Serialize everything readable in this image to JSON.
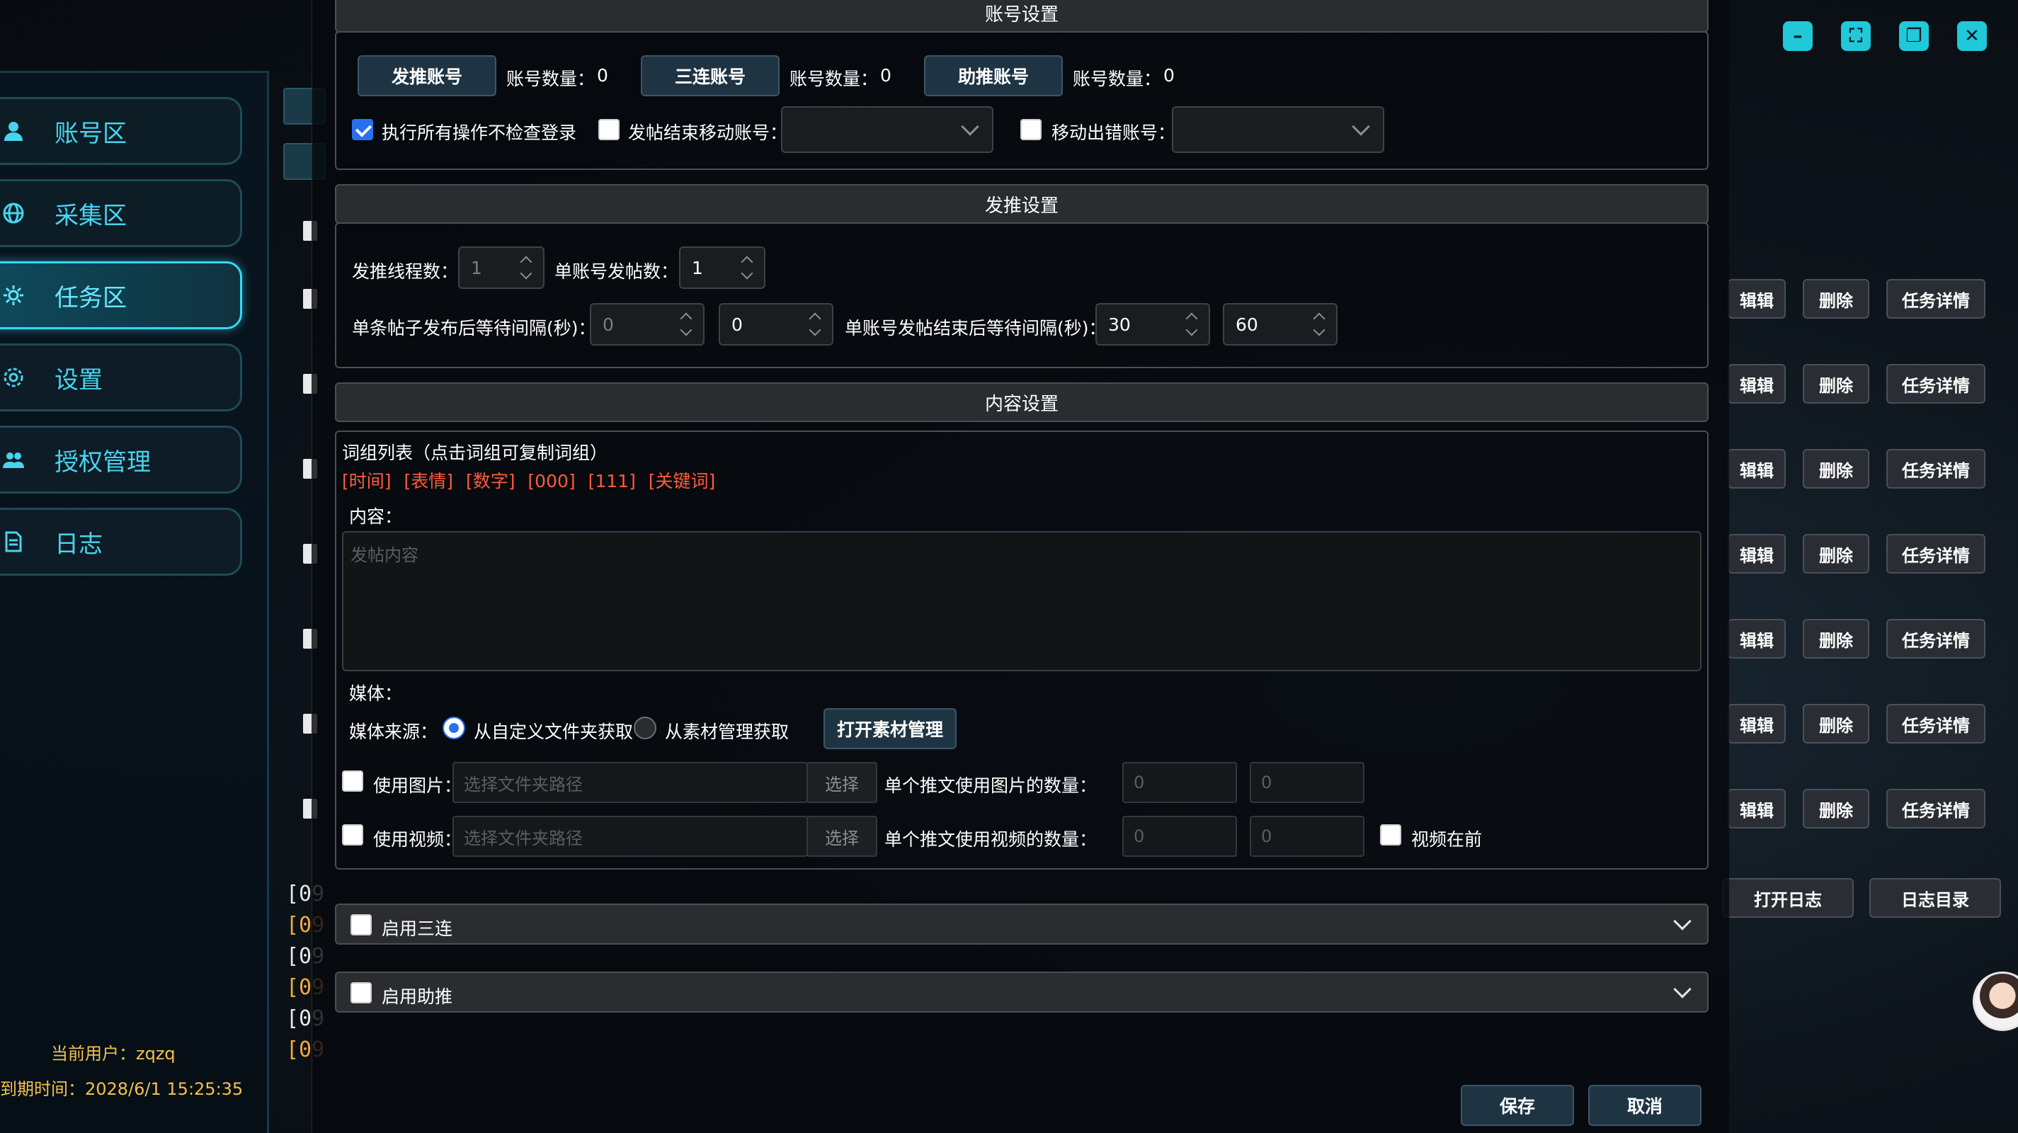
{
  "sidebar": {
    "items": [
      {
        "label": "账号区",
        "icon": "user-icon"
      },
      {
        "label": "采集区",
        "icon": "globe-icon"
      },
      {
        "label": "任务区",
        "icon": "gear-icon"
      },
      {
        "label": "设置",
        "icon": "settings-icon"
      },
      {
        "label": "授权管理",
        "icon": "users-icon"
      },
      {
        "label": "日志",
        "icon": "document-icon"
      }
    ],
    "active_index": 2,
    "user_label": "当前用户：zqzq",
    "expire_label": "到期时间：2028/6/1 15:25:35"
  },
  "log_lines": [
    "[09",
    "[09",
    "[09",
    "[09",
    "[09",
    "[09"
  ],
  "log_colors": [
    "#e6e6e6",
    "#f2a93b",
    "#e6e6e6",
    "#f2a93b",
    "#e6e6e6",
    "#f2a93b"
  ],
  "task_rows": {
    "edit_label": "辑辑",
    "delete_label": "删除",
    "detail_label": "任务详情"
  },
  "log_buttons": {
    "open_log": "打开日志",
    "log_dir": "日志目录"
  },
  "window_icons": [
    "minimize-icon",
    "fullscreen-icon",
    "restore-icon",
    "close-icon"
  ],
  "account_settings": {
    "title": "账号设置",
    "post_account_btn": "发推账号",
    "triple_account_btn": "三连账号",
    "assist_account_btn": "助推账号",
    "count_label": "账号数量：",
    "post_count": "0",
    "triple_count": "0",
    "assist_count": "0",
    "skip_login_check": {
      "label": "执行所有操作不检查登录",
      "checked": true
    },
    "move_after_post": {
      "label": "发帖结束移动账号：",
      "checked": false
    },
    "move_on_error": {
      "label": "移动出错账号：",
      "checked": false
    }
  },
  "post_settings": {
    "title": "发推设置",
    "thread_count_label": "发推线程数：",
    "thread_count": "1",
    "per_account_label": "单账号发帖数：",
    "per_account": "1",
    "wait_after_post_label": "单条帖子发布后等待间隔(秒)：",
    "wait_after_post_min": "0",
    "wait_after_post_max": "0",
    "wait_after_account_label": "单账号发帖结束后等待间隔(秒)：",
    "wait_after_account_min": "30",
    "wait_after_account_max": "60"
  },
  "content_settings": {
    "title": "内容设置",
    "wordgroup_title": "词组列表（点击词组可复制词组）",
    "wordgroup_tags": [
      "[时间]",
      "[表情]",
      "[数字]",
      "[000]",
      "[111]",
      "[关键词]"
    ],
    "content_label": "内容：",
    "content_placeholder": "发帖内容",
    "media_label": "媒体：",
    "media_source_label": "媒体来源：",
    "source_custom": "从自定义文件夹获取",
    "source_material": "从素材管理获取",
    "open_material_btn": "打开素材管理",
    "use_image_label": "使用图片：",
    "use_video_label": "使用视频：",
    "path_placeholder": "选择文件夹路径",
    "choose_btn": "选择",
    "image_count_label": "单个推文使用图片的数量：",
    "video_count_label": "单个推文使用视频的数量：",
    "image_min": "0",
    "image_max": "0",
    "video_min": "0",
    "video_max": "0",
    "video_first_label": "视频在前"
  },
  "enable_triple": "启用三连",
  "enable_assist": "启用助推",
  "footer": {
    "save": "保存",
    "cancel": "取消"
  },
  "colors": {
    "accent_cyan": "#35d8f5",
    "checkbox_blue": "#2a6ff0",
    "tag_red": "#ff5a3c",
    "gold": "#f2c14e"
  }
}
